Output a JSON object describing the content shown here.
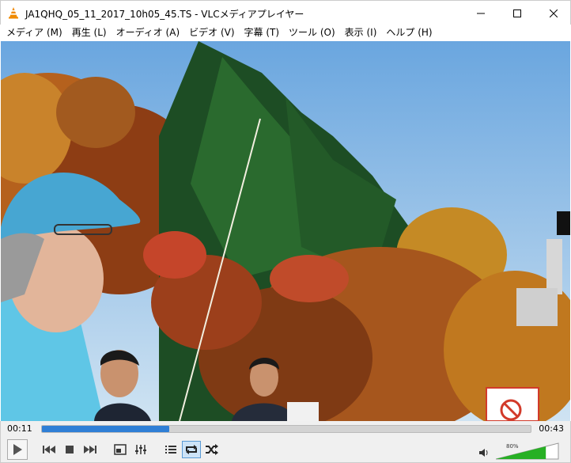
{
  "window": {
    "title": "JA1QHQ_05_11_2017_10h05_45.TS - VLCメディアプレイヤー"
  },
  "menu": {
    "items": [
      {
        "label": "メディア (M)"
      },
      {
        "label": "再生 (L)"
      },
      {
        "label": "オーディオ (A)"
      },
      {
        "label": "ビデオ (V)"
      },
      {
        "label": "字幕 (T)"
      },
      {
        "label": "ツール (O)"
      },
      {
        "label": "表示 (I)"
      },
      {
        "label": "ヘルプ (H)"
      }
    ]
  },
  "player": {
    "elapsed": "00:11",
    "total": "00:43",
    "progress_fraction": 0.26,
    "volume_label": "80%",
    "volume_fraction": 0.8
  },
  "colors": {
    "accent": "#2f7fd6",
    "volume": "#27b024"
  },
  "icons": {
    "app": "vlc-cone-icon",
    "play": "play-icon",
    "prev": "previous-icon",
    "stop": "stop-icon",
    "next": "next-icon",
    "fullscreen": "fullscreen-icon",
    "extended": "extended-settings-icon",
    "playlist": "playlist-icon",
    "loop": "loop-icon",
    "shuffle": "shuffle-icon",
    "volume": "speaker-icon"
  }
}
